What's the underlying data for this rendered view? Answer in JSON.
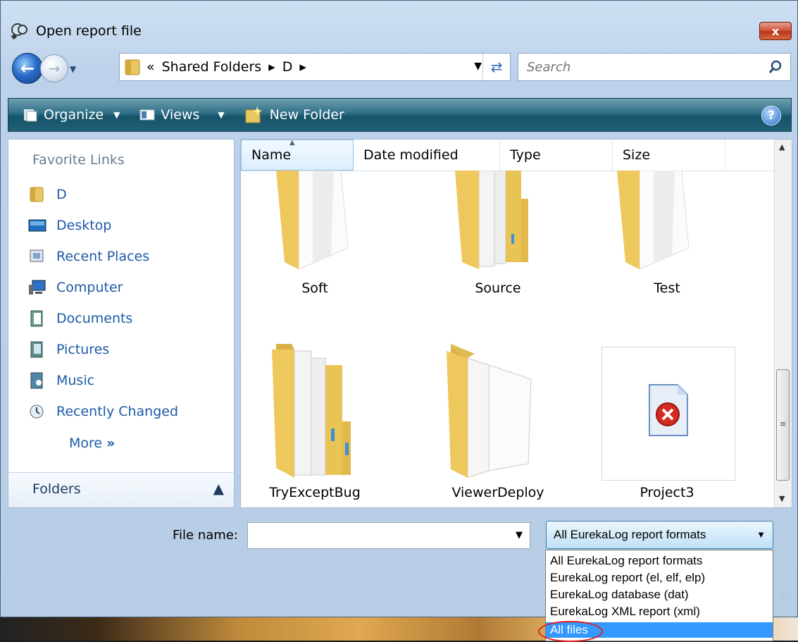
{
  "window": {
    "title": "Open report file",
    "close_label": "x"
  },
  "nav": {
    "breadcrumb": [
      "«",
      "Shared Folders",
      "▸",
      "D",
      "▸"
    ],
    "search_placeholder": "Search"
  },
  "toolbar": {
    "organize": "Organize",
    "views": "Views",
    "new_folder": "New Folder",
    "help": "?"
  },
  "sidebar": {
    "heading": "Favorite Links",
    "items": [
      {
        "label": "D",
        "icon": "folder-icon"
      },
      {
        "label": "Desktop",
        "icon": "desktop-icon"
      },
      {
        "label": "Recent Places",
        "icon": "recent-places-icon"
      },
      {
        "label": "Computer",
        "icon": "computer-icon"
      },
      {
        "label": "Documents",
        "icon": "documents-icon"
      },
      {
        "label": "Pictures",
        "icon": "pictures-icon"
      },
      {
        "label": "Music",
        "icon": "music-icon"
      },
      {
        "label": "Recently Changed",
        "icon": "recently-changed-icon"
      }
    ],
    "more": "More",
    "folders": "Folders"
  },
  "columns": [
    "Name",
    "Date modified",
    "Type",
    "Size"
  ],
  "items": [
    {
      "name": "Soft",
      "icon": "folder-icon"
    },
    {
      "name": "Source",
      "icon": "folder-icon"
    },
    {
      "name": "Test",
      "icon": "folder-icon"
    },
    {
      "name": "TryExceptBug",
      "icon": "folder-icon"
    },
    {
      "name": "ViewerDeploy",
      "icon": "folder-icon"
    },
    {
      "name": "Project3",
      "icon": "error-file-icon"
    }
  ],
  "bottom": {
    "file_name_label": "File name:",
    "file_name_value": "",
    "filter_selected": "All EurekaLog report formats",
    "filter_options": [
      "All EurekaLog report formats",
      "EurekaLog report (el, elf, elp)",
      "EurekaLog database (dat)",
      "EurekaLog XML report (xml)",
      "All files"
    ]
  },
  "colors": {
    "toolbar": "#1f5f75",
    "link": "#1d5aa6",
    "selected": "#3399ff",
    "highlight_circle": "#e02020"
  }
}
